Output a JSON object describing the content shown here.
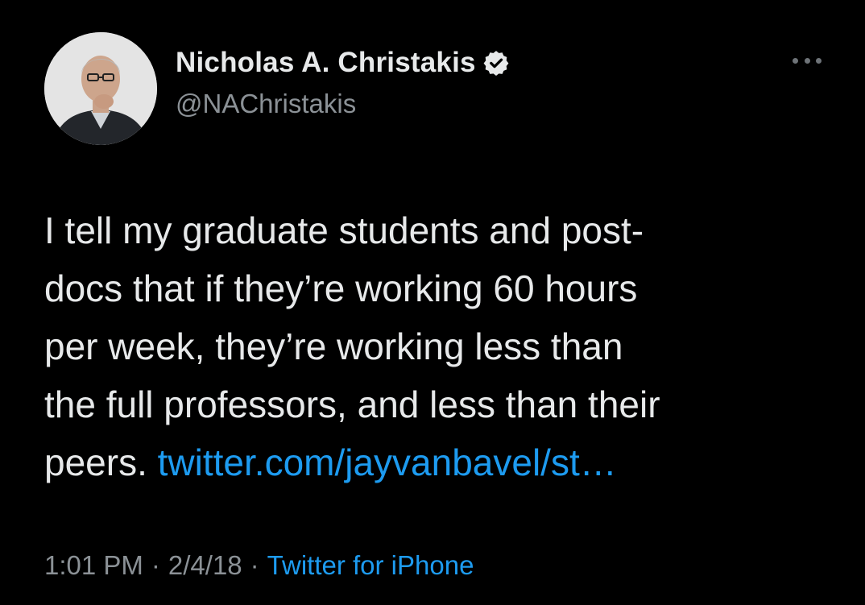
{
  "author": {
    "display_name": "Nicholas A. Christakis",
    "handle": "@NAChristakis",
    "verified": true,
    "avatar_icon": "profile-photo"
  },
  "tweet": {
    "lines": [
      "I tell my graduate students and post-",
      "docs that if they’re working 60 hours",
      "per week, they’re working less than",
      "the full professors, and less than their"
    ],
    "last_line_prefix": "peers. ",
    "link_text": "twitter.com/jayvanbavel/st…"
  },
  "meta": {
    "time": "1:01 PM",
    "separator": "·",
    "date": "2/4/18",
    "source": "Twitter for iPhone"
  },
  "colors": {
    "background": "#000000",
    "text": "#e7e9ea",
    "muted": "#8b9196",
    "link": "#1d9bf0"
  },
  "icons": {
    "more": "more-horizontal-icon",
    "verified": "verified-badge-icon"
  }
}
